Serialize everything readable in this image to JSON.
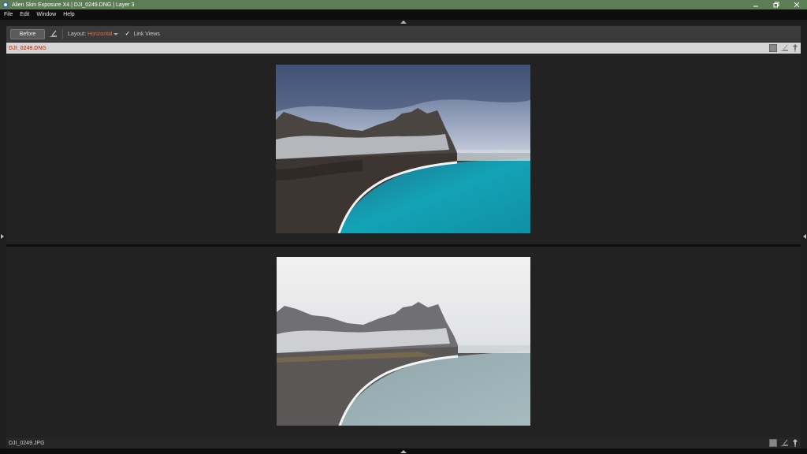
{
  "window": {
    "title": "Alien Skin Exposure X4 | DJI_0249.DNG | Layer 3",
    "minimize_icon": "minimize-icon",
    "restore_icon": "restore-icon",
    "close_icon": "close-icon"
  },
  "menu": {
    "items": [
      {
        "label": "File"
      },
      {
        "label": "Edit"
      },
      {
        "label": "Window"
      },
      {
        "label": "Help"
      }
    ]
  },
  "toolbar": {
    "before_label": "Before",
    "layout_label": "Layout:",
    "layout_value": "Horizontal",
    "link_views_checked": "✓",
    "link_views_label": "Link Views"
  },
  "panes": {
    "top": {
      "filename": "DJI_0249.DNG"
    },
    "bottom": {
      "filename": "DJI_0249.JPG"
    }
  },
  "colors": {
    "titlebar": "#5d7d54",
    "accent_orange": "#e06b3c",
    "filename_top": "#d24f2c"
  }
}
